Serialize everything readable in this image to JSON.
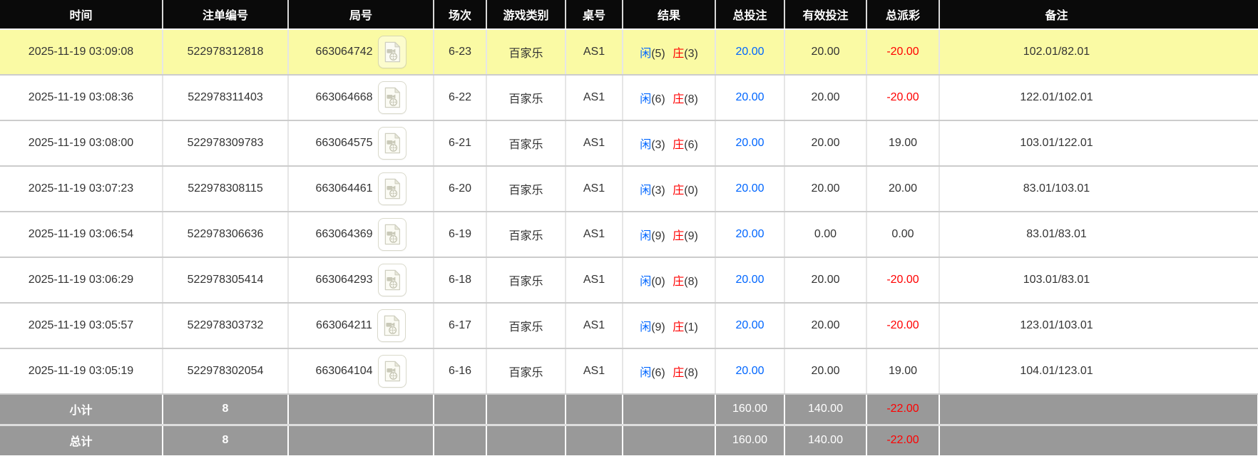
{
  "table": {
    "columns": [
      {
        "key": "time",
        "label": "时间"
      },
      {
        "key": "bet_no",
        "label": "注单编号"
      },
      {
        "key": "round_no",
        "label": "局号"
      },
      {
        "key": "session",
        "label": "场次"
      },
      {
        "key": "game_type",
        "label": "游戏类别"
      },
      {
        "key": "table_no",
        "label": "桌号"
      },
      {
        "key": "result",
        "label": "结果"
      },
      {
        "key": "total_bet",
        "label": "总投注"
      },
      {
        "key": "valid_bet",
        "label": "有效投注"
      },
      {
        "key": "payout",
        "label": "总派彩"
      },
      {
        "key": "remark",
        "label": "备注"
      }
    ],
    "result_labels": {
      "player": "闲",
      "banker": "庄"
    },
    "rows": [
      {
        "time": "2025-11-19 03:09:08",
        "bet_no": "522978312818",
        "round_no": "663064742",
        "session": "6-23",
        "game_type": "百家乐",
        "table_no": "AS1",
        "player_score": "(5)",
        "banker_score": "(3)",
        "total_bet": "20.00",
        "valid_bet": "20.00",
        "payout": "-20.00",
        "remark": "102.01/82.01",
        "highlighted": true
      },
      {
        "time": "2025-11-19 03:08:36",
        "bet_no": "522978311403",
        "round_no": "663064668",
        "session": "6-22",
        "game_type": "百家乐",
        "table_no": "AS1",
        "player_score": "(6)",
        "banker_score": "(8)",
        "total_bet": "20.00",
        "valid_bet": "20.00",
        "payout": "-20.00",
        "remark": "122.01/102.01",
        "highlighted": false
      },
      {
        "time": "2025-11-19 03:08:00",
        "bet_no": "522978309783",
        "round_no": "663064575",
        "session": "6-21",
        "game_type": "百家乐",
        "table_no": "AS1",
        "player_score": "(3)",
        "banker_score": "(6)",
        "total_bet": "20.00",
        "valid_bet": "20.00",
        "payout": "19.00",
        "remark": "103.01/122.01",
        "highlighted": false
      },
      {
        "time": "2025-11-19 03:07:23",
        "bet_no": "522978308115",
        "round_no": "663064461",
        "session": "6-20",
        "game_type": "百家乐",
        "table_no": "AS1",
        "player_score": "(3)",
        "banker_score": "(0)",
        "total_bet": "20.00",
        "valid_bet": "20.00",
        "payout": "20.00",
        "remark": "83.01/103.01",
        "highlighted": false
      },
      {
        "time": "2025-11-19 03:06:54",
        "bet_no": "522978306636",
        "round_no": "663064369",
        "session": "6-19",
        "game_type": "百家乐",
        "table_no": "AS1",
        "player_score": "(9)",
        "banker_score": "(9)",
        "total_bet": "20.00",
        "valid_bet": "0.00",
        "payout": "0.00",
        "remark": "83.01/83.01",
        "highlighted": false
      },
      {
        "time": "2025-11-19 03:06:29",
        "bet_no": "522978305414",
        "round_no": "663064293",
        "session": "6-18",
        "game_type": "百家乐",
        "table_no": "AS1",
        "player_score": "(0)",
        "banker_score": "(8)",
        "total_bet": "20.00",
        "valid_bet": "20.00",
        "payout": "-20.00",
        "remark": "103.01/83.01",
        "highlighted": false
      },
      {
        "time": "2025-11-19 03:05:57",
        "bet_no": "522978303732",
        "round_no": "663064211",
        "session": "6-17",
        "game_type": "百家乐",
        "table_no": "AS1",
        "player_score": "(9)",
        "banker_score": "(1)",
        "total_bet": "20.00",
        "valid_bet": "20.00",
        "payout": "-20.00",
        "remark": "123.01/103.01",
        "highlighted": false
      },
      {
        "time": "2025-11-19 03:05:19",
        "bet_no": "522978302054",
        "round_no": "663064104",
        "session": "6-16",
        "game_type": "百家乐",
        "table_no": "AS1",
        "player_score": "(6)",
        "banker_score": "(8)",
        "total_bet": "20.00",
        "valid_bet": "20.00",
        "payout": "19.00",
        "remark": "104.01/123.01",
        "highlighted": false
      }
    ],
    "summary_rows": [
      {
        "label": "小计",
        "count": "8",
        "total_bet": "160.00",
        "valid_bet": "140.00",
        "payout": "-22.00"
      },
      {
        "label": "总计",
        "count": "8",
        "total_bet": "160.00",
        "valid_bet": "140.00",
        "payout": "-22.00"
      }
    ]
  },
  "icons": {
    "video_button": "video-file-icon"
  },
  "colors": {
    "header_bg": "#0a0a0a",
    "highlight_row_bg": "#fafaa4",
    "summary_bg": "#999999",
    "player_blue": "#0066ff",
    "banker_red": "#ff0000",
    "bet_amount_blue": "#0066ff",
    "negative_red": "#ff0000"
  }
}
